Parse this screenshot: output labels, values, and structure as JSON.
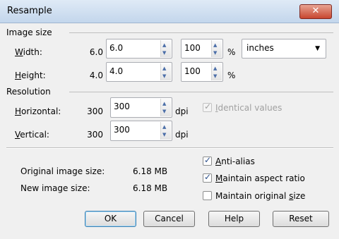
{
  "dialog": {
    "title": "Resample",
    "close_label": "✕"
  },
  "image_size": {
    "heading": "Image size",
    "width": {
      "label": "Width:",
      "original": "6.0",
      "value": "6.0",
      "percent": "100"
    },
    "height": {
      "label": "Height:",
      "original": "4.0",
      "value": "4.0",
      "percent": "100"
    },
    "percent_symbol": "%",
    "units": {
      "selected": "inches"
    }
  },
  "resolution": {
    "heading": "Resolution",
    "horizontal": {
      "label": "Horizontal:",
      "original": "300",
      "value": "300",
      "unit": "dpi"
    },
    "vertical": {
      "label": "Vertical:",
      "original": "300",
      "value": "300",
      "unit": "dpi"
    },
    "identical_values": {
      "label": "Identical values",
      "checked": true,
      "enabled": false
    }
  },
  "summary": {
    "original_label": "Original image size:",
    "original_value": "6.18 MB",
    "new_label": "New image size:",
    "new_value": "6.18 MB"
  },
  "options": {
    "anti_alias": {
      "label": "Anti-alias",
      "checked": true
    },
    "maintain_aspect": {
      "label": "Maintain aspect ratio",
      "checked": true
    },
    "maintain_size": {
      "label": "Maintain original size",
      "checked": false
    }
  },
  "buttons": {
    "ok": "OK",
    "cancel": "Cancel",
    "help": "Help",
    "reset": "Reset"
  },
  "icons": {
    "up": "▲",
    "down": "▼",
    "dropdown": "▼",
    "check": "✓"
  }
}
